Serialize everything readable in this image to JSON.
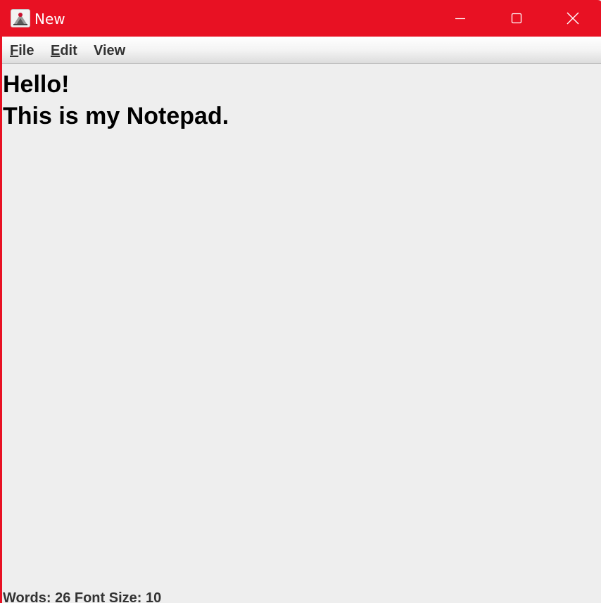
{
  "window": {
    "title": "New",
    "accent_color": "#e81123",
    "icons": {
      "app": "java-app-icon",
      "minimize": "minimize-icon",
      "maximize": "maximize-icon",
      "close": "close-icon"
    }
  },
  "menu": {
    "file": {
      "mnemonic": "F",
      "rest": "ile"
    },
    "edit": {
      "mnemonic": "E",
      "rest": "dit"
    },
    "view": {
      "label": "View"
    }
  },
  "editor": {
    "text": "Hello!\nThis is my Notepad."
  },
  "status": {
    "text": "Words: 26 Font Size: 10"
  }
}
